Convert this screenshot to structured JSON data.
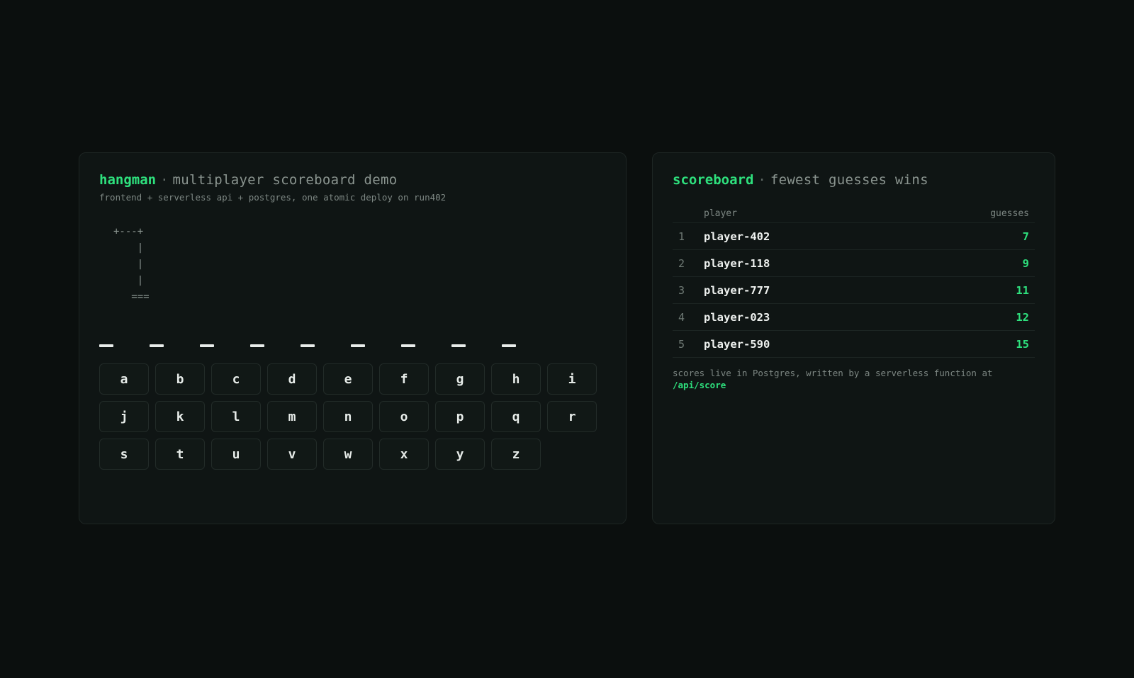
{
  "game": {
    "title": "hangman",
    "separator": "·",
    "title_rest": "multiplayer scoreboard demo",
    "subtitle": "frontend + serverless api + postgres, one atomic deploy on run402",
    "gallows_ascii": "+---+\n    |\n    |\n    |\n   ===",
    "word_slots": [
      "",
      "",
      "",
      "",
      "",
      "",
      "",
      "",
      ""
    ],
    "keys_row1": [
      "a",
      "b",
      "c",
      "d",
      "e",
      "f",
      "g",
      "h",
      "i"
    ],
    "keys_row2": [
      "j",
      "k",
      "l",
      "m",
      "n",
      "o",
      "p",
      "q",
      "r"
    ],
    "keys_row3": [
      "s",
      "t",
      "u",
      "v",
      "w",
      "x",
      "y",
      "z"
    ]
  },
  "scoreboard": {
    "title": "scoreboard",
    "separator": "·",
    "title_rest": "fewest guesses wins",
    "header_player": "player",
    "header_guesses": "guesses",
    "rows": [
      {
        "rank": "1",
        "player": "player-402",
        "guesses": "7"
      },
      {
        "rank": "2",
        "player": "player-118",
        "guesses": "9"
      },
      {
        "rank": "3",
        "player": "player-777",
        "guesses": "11"
      },
      {
        "rank": "4",
        "player": "player-023",
        "guesses": "12"
      },
      {
        "rank": "5",
        "player": "player-590",
        "guesses": "15"
      }
    ],
    "footnote": "scores live in Postgres, written by a serverless function at",
    "api_path": "/api/score"
  },
  "colors": {
    "accent": "#2ee07d",
    "background": "#0b0f0e",
    "card": "#0f1514"
  }
}
